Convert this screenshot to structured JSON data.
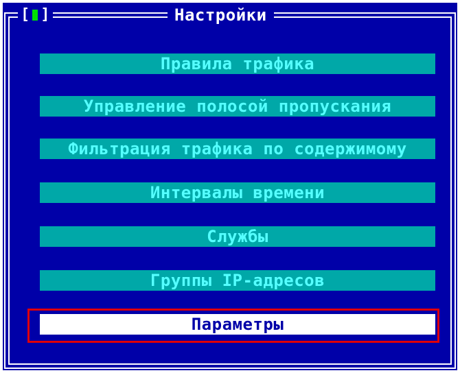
{
  "window": {
    "title": "Настройки",
    "close_label": "[",
    "close_label_end": "]"
  },
  "menu": {
    "items": [
      {
        "label": "Правила трафика"
      },
      {
        "label": "Управление полосой пропускания"
      },
      {
        "label": "Фильтрация трафика по содержимому"
      },
      {
        "label": "Интервалы времени"
      },
      {
        "label": "Службы"
      },
      {
        "label": "Группы IP-адресов"
      },
      {
        "label": "Параметры",
        "selected": true
      }
    ]
  },
  "colors": {
    "background": "#0000a8",
    "button": "#00a8a8",
    "button_text": "#55ffff",
    "selected_bg": "#ffffff",
    "selected_text": "#0000a8",
    "highlight_border": "#e00000"
  }
}
